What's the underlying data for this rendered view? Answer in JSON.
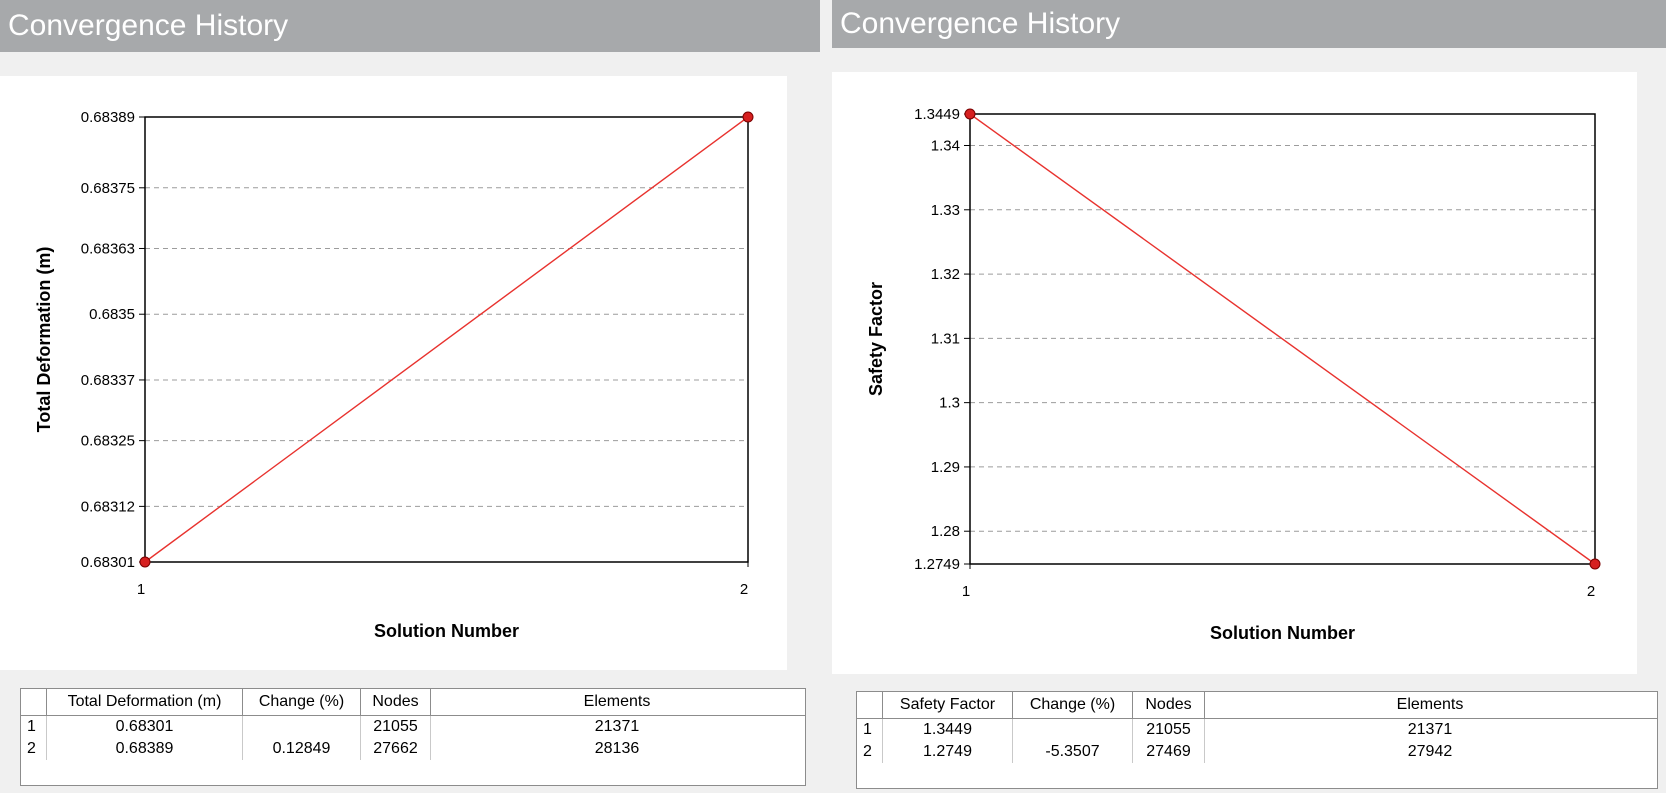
{
  "panels": [
    {
      "title": "Convergence History",
      "table": {
        "columns": [
          "",
          "Total Deformation (m)",
          "Change (%)",
          "Nodes",
          "Elements"
        ],
        "rows": [
          [
            "1",
            "0.68301",
            "",
            "21055",
            "21371"
          ],
          [
            "2",
            "0.68389",
            "0.12849",
            "27662",
            "28136"
          ]
        ]
      }
    },
    {
      "title": "Convergence History",
      "table": {
        "columns": [
          "",
          "Safety Factor",
          "Change (%)",
          "Nodes",
          "Elements"
        ],
        "rows": [
          [
            "1",
            "1.3449",
            "",
            "21055",
            "21371"
          ],
          [
            "2",
            "1.2749",
            "-5.3507",
            "27469",
            "27942"
          ]
        ]
      }
    }
  ],
  "colors": {
    "series": "#e8322e",
    "marker": "#d62020",
    "grid": "#9c9c9c",
    "header": "#a7a9ab"
  },
  "chart_data": [
    {
      "type": "line",
      "xlabel": "Solution Number",
      "ylabel": "Total Deformation (m)",
      "x": [
        1,
        2
      ],
      "x_ticks": [
        "1",
        "2"
      ],
      "values": [
        0.68301,
        0.68389
      ],
      "ylim": [
        0.68301,
        0.68389
      ],
      "y_ticks": [
        "0.68301",
        "0.68312",
        "0.68325",
        "0.68337",
        "0.6835",
        "0.68363",
        "0.68375",
        "0.68389"
      ],
      "grid": true
    },
    {
      "type": "line",
      "xlabel": "Solution Number",
      "ylabel": "Safety Factor",
      "x": [
        1,
        2
      ],
      "x_ticks": [
        "1",
        "2"
      ],
      "values": [
        1.3449,
        1.2749
      ],
      "ylim": [
        1.2749,
        1.3449
      ],
      "y_ticks": [
        "1.2749",
        "1.28",
        "1.29",
        "1.3",
        "1.31",
        "1.32",
        "1.33",
        "1.34",
        "1.3449"
      ],
      "grid": true
    }
  ]
}
